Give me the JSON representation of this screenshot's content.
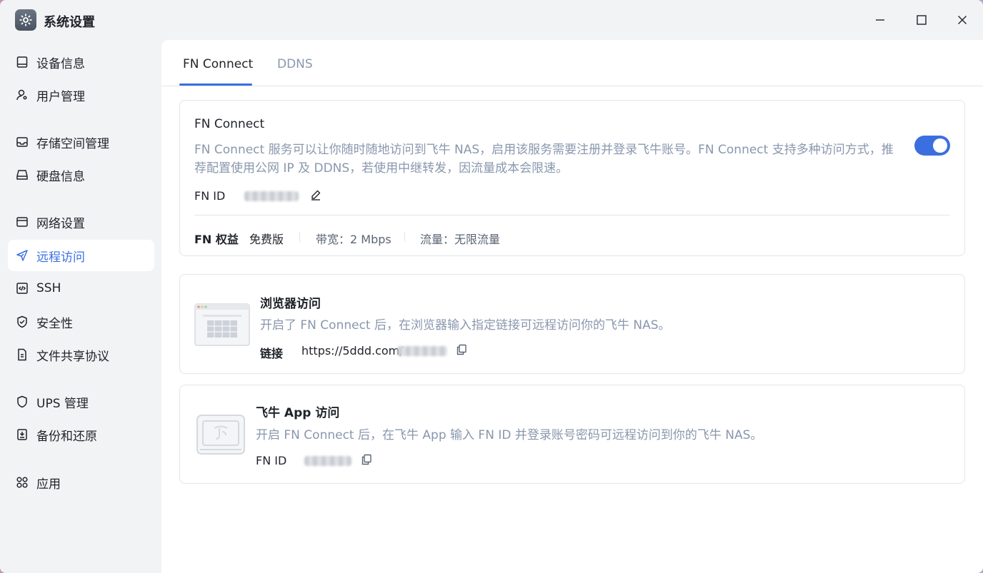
{
  "window": {
    "title": "系统设置"
  },
  "sidebar": {
    "items": [
      {
        "label": "设备信息",
        "icon": "device-icon"
      },
      {
        "label": "用户管理",
        "icon": "user-icon"
      },
      {
        "label": "存储空间管理",
        "icon": "storage-icon"
      },
      {
        "label": "硬盘信息",
        "icon": "disk-icon"
      },
      {
        "label": "网络设置",
        "icon": "network-icon"
      },
      {
        "label": "远程访问",
        "icon": "send-icon",
        "active": true
      },
      {
        "label": "SSH",
        "icon": "code-icon"
      },
      {
        "label": "安全性",
        "icon": "shield-check-icon"
      },
      {
        "label": "文件共享协议",
        "icon": "file-icon"
      },
      {
        "label": "UPS 管理",
        "icon": "shield-icon"
      },
      {
        "label": "备份和还原",
        "icon": "backup-icon"
      },
      {
        "label": "应用",
        "icon": "apps-icon"
      }
    ]
  },
  "tabs": [
    {
      "label": "FN Connect",
      "active": true
    },
    {
      "label": "DDNS",
      "active": false
    }
  ],
  "fn_connect": {
    "title": "FN Connect",
    "description_line1": "FN Connect 服务可以让你随时随地访问到飞牛 NAS，启用该服务需要注册并登录飞牛账号。FN Connect 支持多种访问方式，推",
    "description_line2": "荐配置使用公网 IP 及 DDNS，若使用中继转发，因流量成本会限速。",
    "enabled": true,
    "fn_id_label": "FN ID",
    "benefits_label": "FN 权益",
    "plan": "免费版",
    "bandwidth": "带宽：2 Mbps",
    "traffic": "流量：无限流量"
  },
  "browser_access": {
    "title": "浏览器访问",
    "description": "开启了 FN Connect 后，在浏览器输入指定链接可远程访问你的飞牛 NAS。",
    "link_label": "链接",
    "link_prefix": "https://5ddd.com/"
  },
  "app_access": {
    "title": "飞牛 App 访问",
    "description": "开启 FN Connect 后，在飞牛 App 输入 FN ID 并登录账号密码可远程访问到你的飞牛 NAS。",
    "fn_id_label": "FN ID"
  },
  "colors": {
    "accent": "#3b6fe0",
    "muted_text": "#8a97ad",
    "sidebar_bg": "#f2f3f5"
  }
}
